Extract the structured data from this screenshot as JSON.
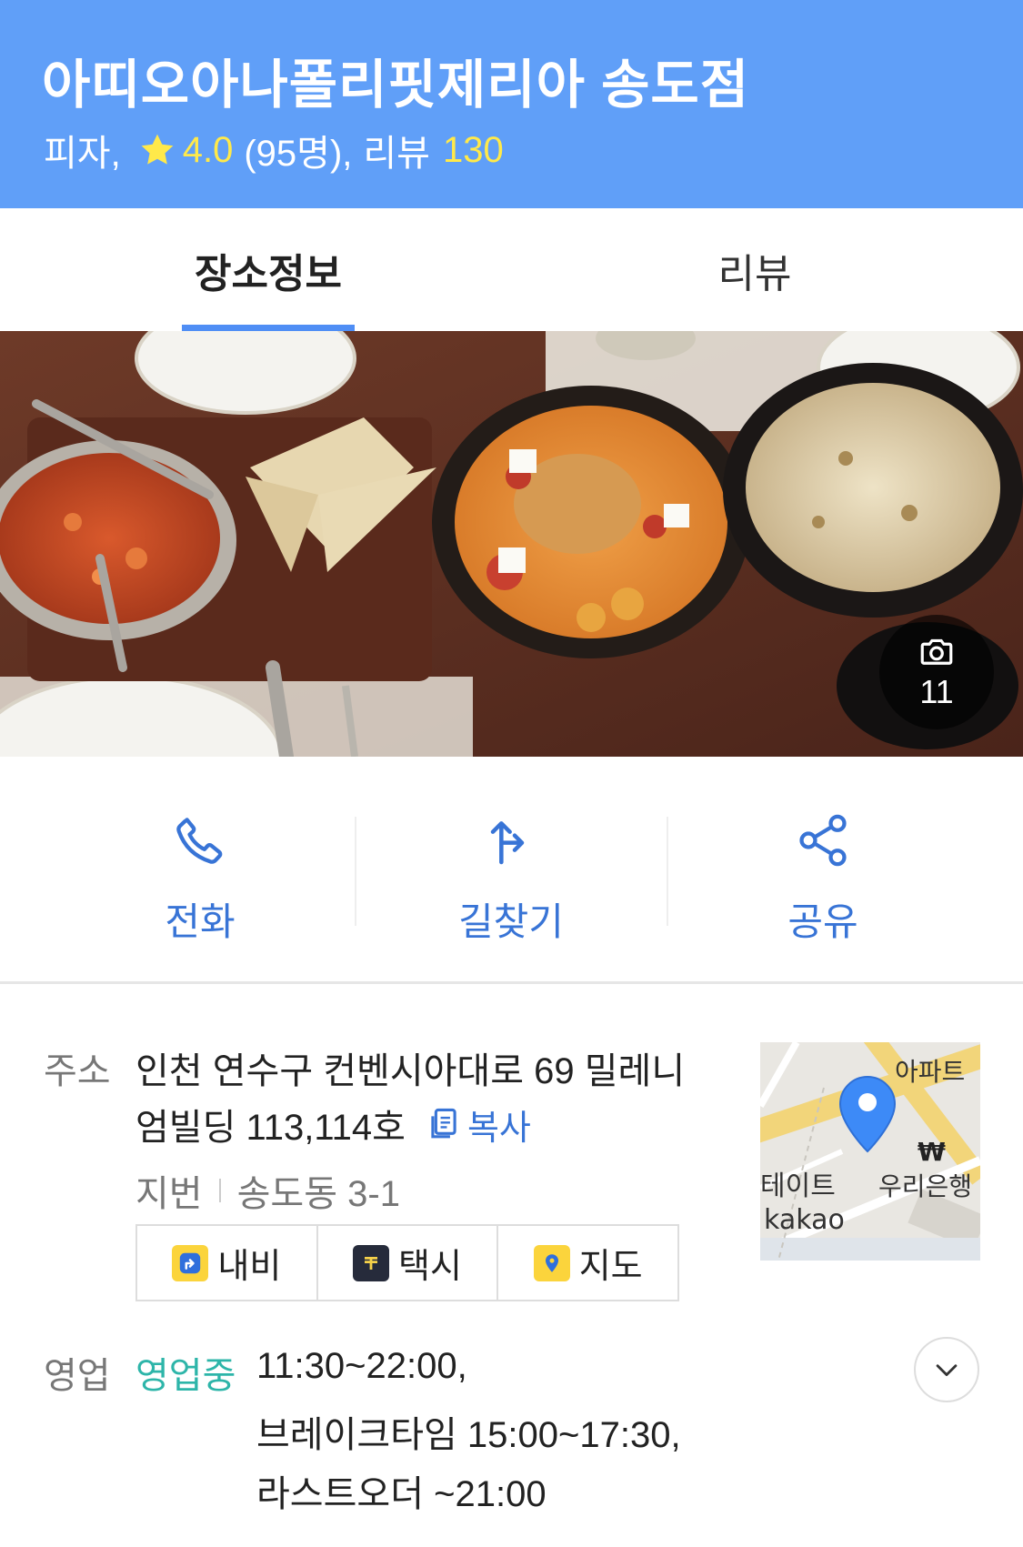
{
  "header": {
    "title": "아띠오아나폴리핏제리아 송도점",
    "category": "피자,",
    "rating": "4.0",
    "rating_count": "(95명),",
    "review_label": "리뷰",
    "review_count": "130"
  },
  "tabs": [
    {
      "label": "장소정보",
      "active": true
    },
    {
      "label": "리뷰",
      "active": false
    }
  ],
  "photo": {
    "count": "11"
  },
  "actions": {
    "call": "전화",
    "route": "길찾기",
    "share": "공유"
  },
  "address": {
    "label": "주소",
    "line1": "인천 연수구 컨벤시아대로 69 밀레니",
    "line2": "엄빌딩 113,114호",
    "copy": "복사",
    "jibun_label": "지번",
    "jibun": "송도동 3-1",
    "buttons": {
      "navi": "내비",
      "taxi": "택시",
      "map": "지도"
    }
  },
  "minimap": {
    "labels": [
      "아파트",
      "테이트",
      "우리은행",
      "kakao"
    ]
  },
  "hours": {
    "label": "영업",
    "status": "영업중",
    "line1": "11:30~22:00,",
    "line2": "브레이크타임 15:00~17:30,",
    "line3": "라스트오더 ~21:00"
  },
  "colors": {
    "header_bg": "#609ff8",
    "accent_blue": "#3874d6",
    "rating_yellow": "#ffe94a",
    "open_teal": "#2db5a9"
  }
}
